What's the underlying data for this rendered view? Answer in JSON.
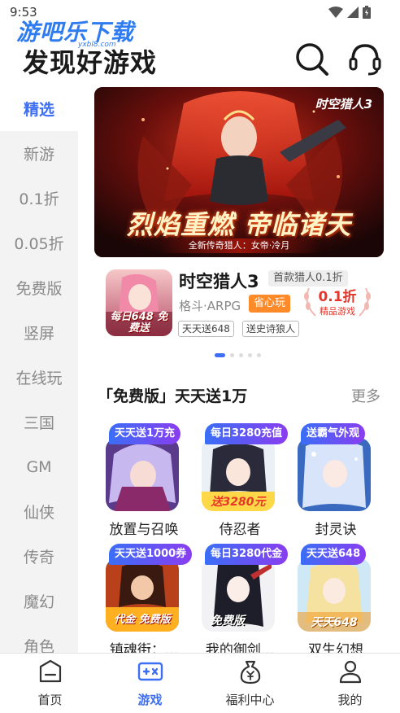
{
  "status_bar": {
    "time": "9:53"
  },
  "watermark": {
    "text": "游吧乐下载",
    "sub": "yxbl8.com"
  },
  "header": {
    "title": "发现好游戏"
  },
  "sidebar": {
    "items": [
      {
        "label": "精选",
        "active": true
      },
      {
        "label": "新游"
      },
      {
        "label": "0.1折"
      },
      {
        "label": "0.05折"
      },
      {
        "label": "免费版"
      },
      {
        "label": "竖屏"
      },
      {
        "label": "在线玩"
      },
      {
        "label": "三国"
      },
      {
        "label": "GM"
      },
      {
        "label": "仙侠"
      },
      {
        "label": "传奇"
      },
      {
        "label": "魔幻"
      },
      {
        "label": "角色"
      }
    ]
  },
  "banner": {
    "game_logo": "时空猎人3",
    "slogan": "烈焰重燃 帝临诸天",
    "subtitle": "全新传奇猎人：女帝·冷月"
  },
  "featured": {
    "name": "时空猎人3",
    "badge": "首款猎人0.1折",
    "genre": "格斗·ARPG",
    "orange_tag": "省心玩",
    "chips": [
      "天天送648",
      "送史诗狼人"
    ],
    "discount_value": "0.1折",
    "discount_label": "精品游戏",
    "icon_caption": "每日648 免费送"
  },
  "section": {
    "title": "「免费版」天天送1万",
    "more": "更多"
  },
  "games": [
    {
      "name": "放置与召唤",
      "tag": "天天送1万充"
    },
    {
      "name": "侍忍者",
      "tag": "每日3280充值"
    },
    {
      "name": "封灵诀",
      "tag": "送霸气外观"
    },
    {
      "name": "镇魂街：...",
      "tag": "天天送1000券"
    },
    {
      "name": "我的御剑...",
      "tag": "每日3280代金"
    },
    {
      "name": "双生幻想",
      "tag": "天天送648"
    }
  ],
  "icon_overlays": {
    "g2": "送3280元",
    "g4": "代金 免费版",
    "g5": "免费版",
    "g6": "天天648"
  },
  "bottom_nav": [
    {
      "label": "首页"
    },
    {
      "label": "游戏",
      "active": true
    },
    {
      "label": "福利中心"
    },
    {
      "label": "我的"
    }
  ],
  "colors": {
    "accent": "#3d6ef6",
    "discount": "#e8352a",
    "orange_tag": "#ff8a2a"
  }
}
